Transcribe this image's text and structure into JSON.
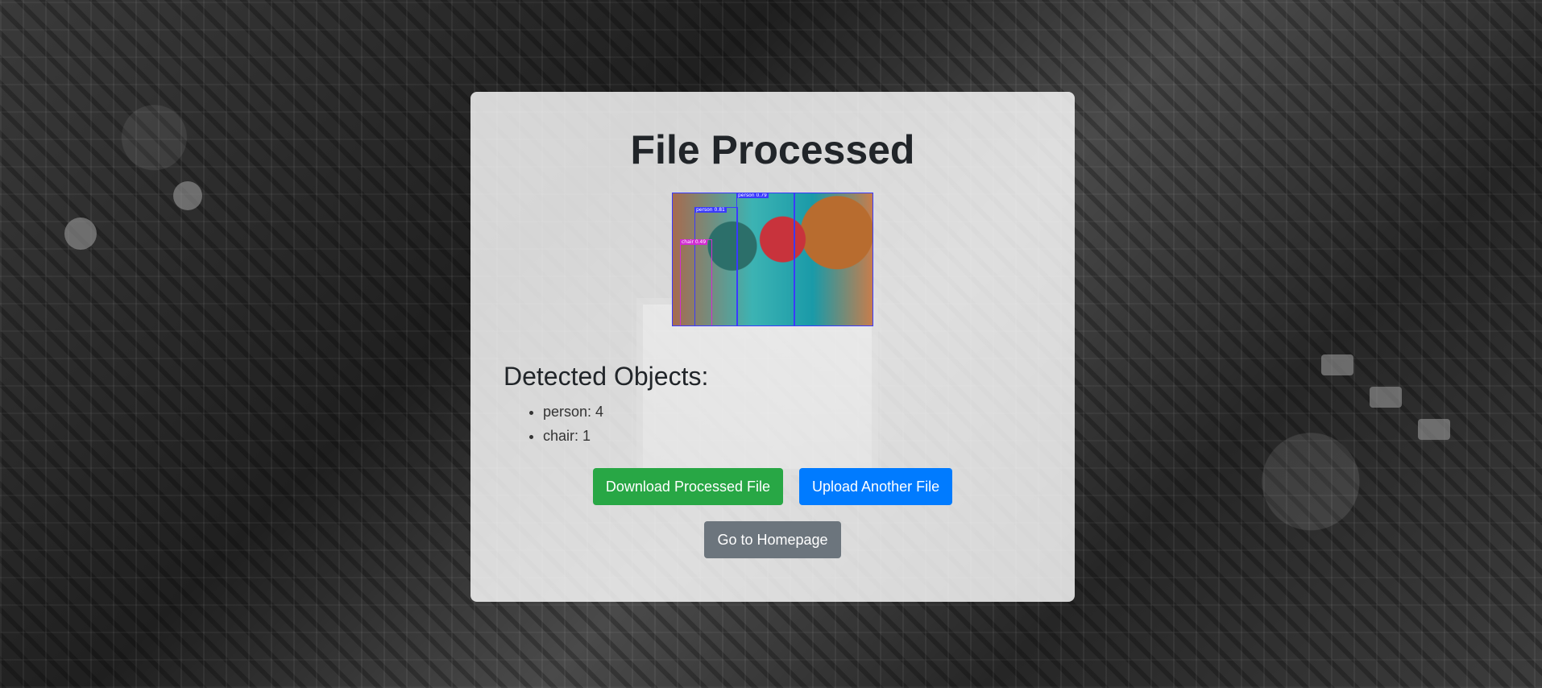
{
  "page": {
    "title": "File Processed"
  },
  "result_image": {
    "detections": [
      {
        "label": "person 0.81",
        "class": "person"
      },
      {
        "label": "person 0.79",
        "class": "person"
      },
      {
        "label": "chair 0.49",
        "class": "chair"
      },
      {
        "label": "person",
        "class": "person"
      },
      {
        "label": "person",
        "class": "person"
      }
    ]
  },
  "detected": {
    "heading": "Detected Objects:",
    "items": [
      "person: 4",
      "chair: 1"
    ]
  },
  "actions": {
    "download_label": "Download Processed File",
    "upload_label": "Upload Another File",
    "home_label": "Go to Homepage"
  },
  "colors": {
    "download": "#28a745",
    "upload": "#007bff",
    "home": "#6c757d",
    "bbox_person": "#3a3aff",
    "bbox_chair": "#d22cd2"
  }
}
